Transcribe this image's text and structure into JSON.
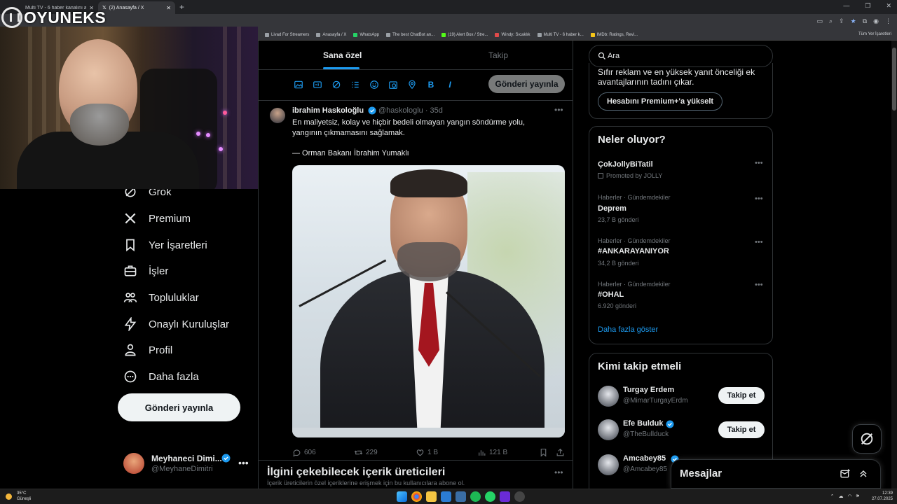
{
  "browser": {
    "tabs": [
      {
        "title": "Multi TV - 6 haber kanalını aynı"
      },
      {
        "title": "(2) Anasayfa / X"
      }
    ],
    "bookmarks": [
      "Livad For Streamers",
      "Anasayfa / X",
      "WhatsApp",
      "The best ChatBot an...",
      "(19) Alert Box / Stre...",
      "Windy: Sıcaklık",
      "Multi TV - 6 haber k...",
      "IMDb: Ratings, Revi..."
    ],
    "bookmarks_right": "Tüm Yer İşaretleri"
  },
  "overlay": {
    "logo_text": "OYUNEKS"
  },
  "nav": {
    "items": [
      {
        "label": "Grok",
        "icon": "grok-icon"
      },
      {
        "label": "Premium",
        "icon": "x-logo-icon"
      },
      {
        "label": "Yer İşaretleri",
        "icon": "bookmark-icon"
      },
      {
        "label": "İşler",
        "icon": "briefcase-icon"
      },
      {
        "label": "Topluluklar",
        "icon": "communities-icon"
      },
      {
        "label": "Onaylı Kuruluşlar",
        "icon": "lightning-icon"
      },
      {
        "label": "Profil",
        "icon": "person-icon"
      },
      {
        "label": "Daha fazla",
        "icon": "more-circle-icon"
      }
    ],
    "post_button": "Gönderi yayınla",
    "account": {
      "name": "Meyhaneci Dimi...",
      "handle": "@MeyhaneDimitri"
    }
  },
  "feed": {
    "tabs": [
      "Sana özel",
      "Takip"
    ],
    "composer_post": "Gönderi yayınla",
    "tweet": {
      "name": "ibrahim Haskoloğlu",
      "handle": "@haskologlu · 35d",
      "text_lines": [
        "En maliyetsiz, kolay ve hiçbir bedeli olmayan yangın söndürme yolu,",
        "yangının çıkmamasını sağlamak.",
        "",
        "— Orman Bakanı İbrahim Yumaklı"
      ],
      "stats": {
        "replies": "606",
        "reposts": "229",
        "likes": "1 B",
        "views": "121 B"
      }
    },
    "suggest_title": "İlgini çekebilecek içerik üreticileri",
    "suggest_sub": "İçerik üreticilerin özel içeriklerine erişmek için bu kullanıcılara abone ol."
  },
  "search": {
    "placeholder": "Ara"
  },
  "premium": {
    "line1": "Sıfır reklam ve en yüksek yanıt önceliği ek",
    "line2": "avantajlarının tadını çıkar.",
    "button": "Hesabını Premium+'a yükselt"
  },
  "trends": {
    "title": "Neler oluyor?",
    "items": [
      {
        "context": "",
        "name": "ÇokJollyBiTatil",
        "count": "Promoted by JOLLY"
      },
      {
        "context": "Haberler · Gündemdekiler",
        "name": "Deprem",
        "count": "23,7 B gönderi"
      },
      {
        "context": "Haberler · Gündemdekiler",
        "name": "#ANKARAYANIYOR",
        "count": "34,2 B gönderi"
      },
      {
        "context": "Haberler · Gündemdekiler",
        "name": "#OHAL",
        "count": "6.920 gönderi"
      }
    ],
    "show_more": "Daha fazla göster"
  },
  "who_to_follow": {
    "title": "Kimi takip etmeli",
    "users": [
      {
        "name": "Turgay Erdem",
        "handle": "@MimarTurgayErdm",
        "button": "Takip et"
      },
      {
        "name": "Efe Bulduk",
        "handle": "@TheBullduck",
        "button": "Takip et"
      },
      {
        "name": "Amcabey85",
        "handle": "@Amcabey85",
        "button": ""
      }
    ]
  },
  "messages": {
    "title": "Mesajlar"
  },
  "taskbar": {
    "weather_temp": "35°C",
    "weather_desc": "Güneşli",
    "time": "12:39",
    "date": "27.07.2025"
  },
  "colors": {
    "accent": "#1d9bf0",
    "background": "#000000",
    "border": "#2f3336",
    "muted": "#71767b"
  }
}
